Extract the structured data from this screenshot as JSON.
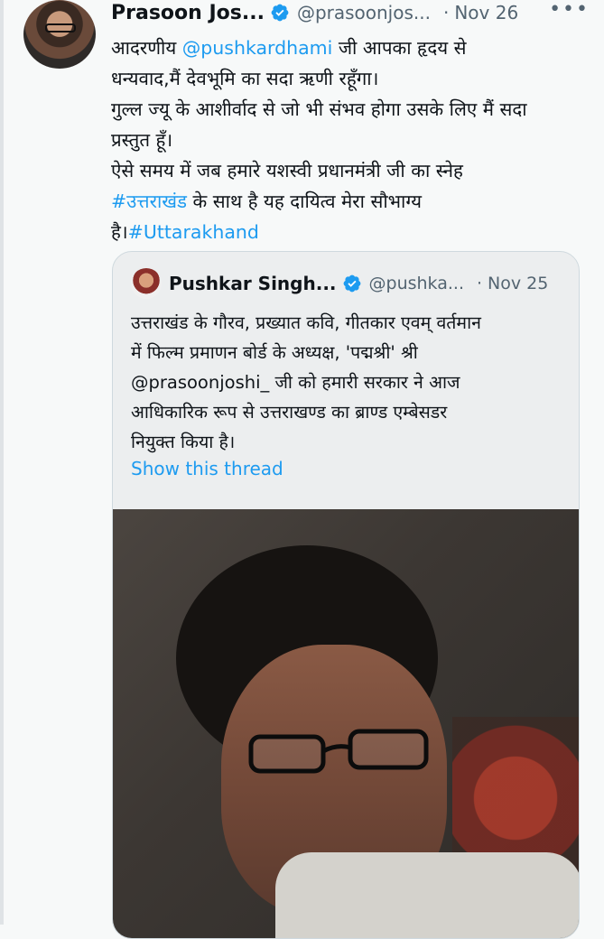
{
  "tweet": {
    "author_name": "Prasoon Jos...",
    "author_handle": "@prasoonjos...",
    "separator": "·",
    "date": "Nov 26",
    "more_label": "•••",
    "text_lines": [
      {
        "pre": "आदरणीय ",
        "link": "@pushkardhami",
        "post": " जी आपका हृदय से"
      },
      {
        "pre": "धन्यवाद,मैं देवभूमि का सदा ऋणी रहूँगा।",
        "link": "",
        "post": ""
      },
      {
        "pre": "गुल्ल ज्यू के आशीर्वाद से जो भी संभव होगा उसके लिए मैं सदा",
        "link": "",
        "post": ""
      },
      {
        "pre": "प्रस्तुत हूँ।",
        "link": "",
        "post": ""
      },
      {
        "pre": "ऐसे समय में जब हमारे यशस्वी प्रधानमंत्री जी का स्नेह",
        "link": "",
        "post": ""
      },
      {
        "pre": "",
        "link": "#उत्तराखंड",
        "post": " के साथ है यह दायित्व मेरा सौभाग्य"
      },
      {
        "pre": "है।",
        "link": "#Uttarakhand",
        "post": ""
      }
    ]
  },
  "quoted": {
    "author_name": "Pushkar Singh...",
    "author_handle": "@pushka...",
    "separator": "·",
    "date": "Nov 25",
    "text_lines": [
      "उत्तराखंड के गौरव, प्रख्यात कवि, गीतकार एवम् वर्तमान",
      "में फिल्म प्रमाणन बोर्ड के अध्यक्ष, 'पद्मश्री' श्री",
      "@prasoonjoshi_ जी को हमारी सरकार ने आज",
      "आधिकारिक रूप से उत्तराखण्ड का ब्राण्ड एम्बेसडर",
      "नियुक्त किया है।"
    ],
    "show_thread": "Show this thread"
  },
  "colors": {
    "link": "#1d9bf0",
    "secondary_text": "#536471",
    "verified_badge": "#1d9bf0"
  },
  "icons": {
    "verified": "verified-badge-icon",
    "more": "more-horizontal-icon"
  }
}
